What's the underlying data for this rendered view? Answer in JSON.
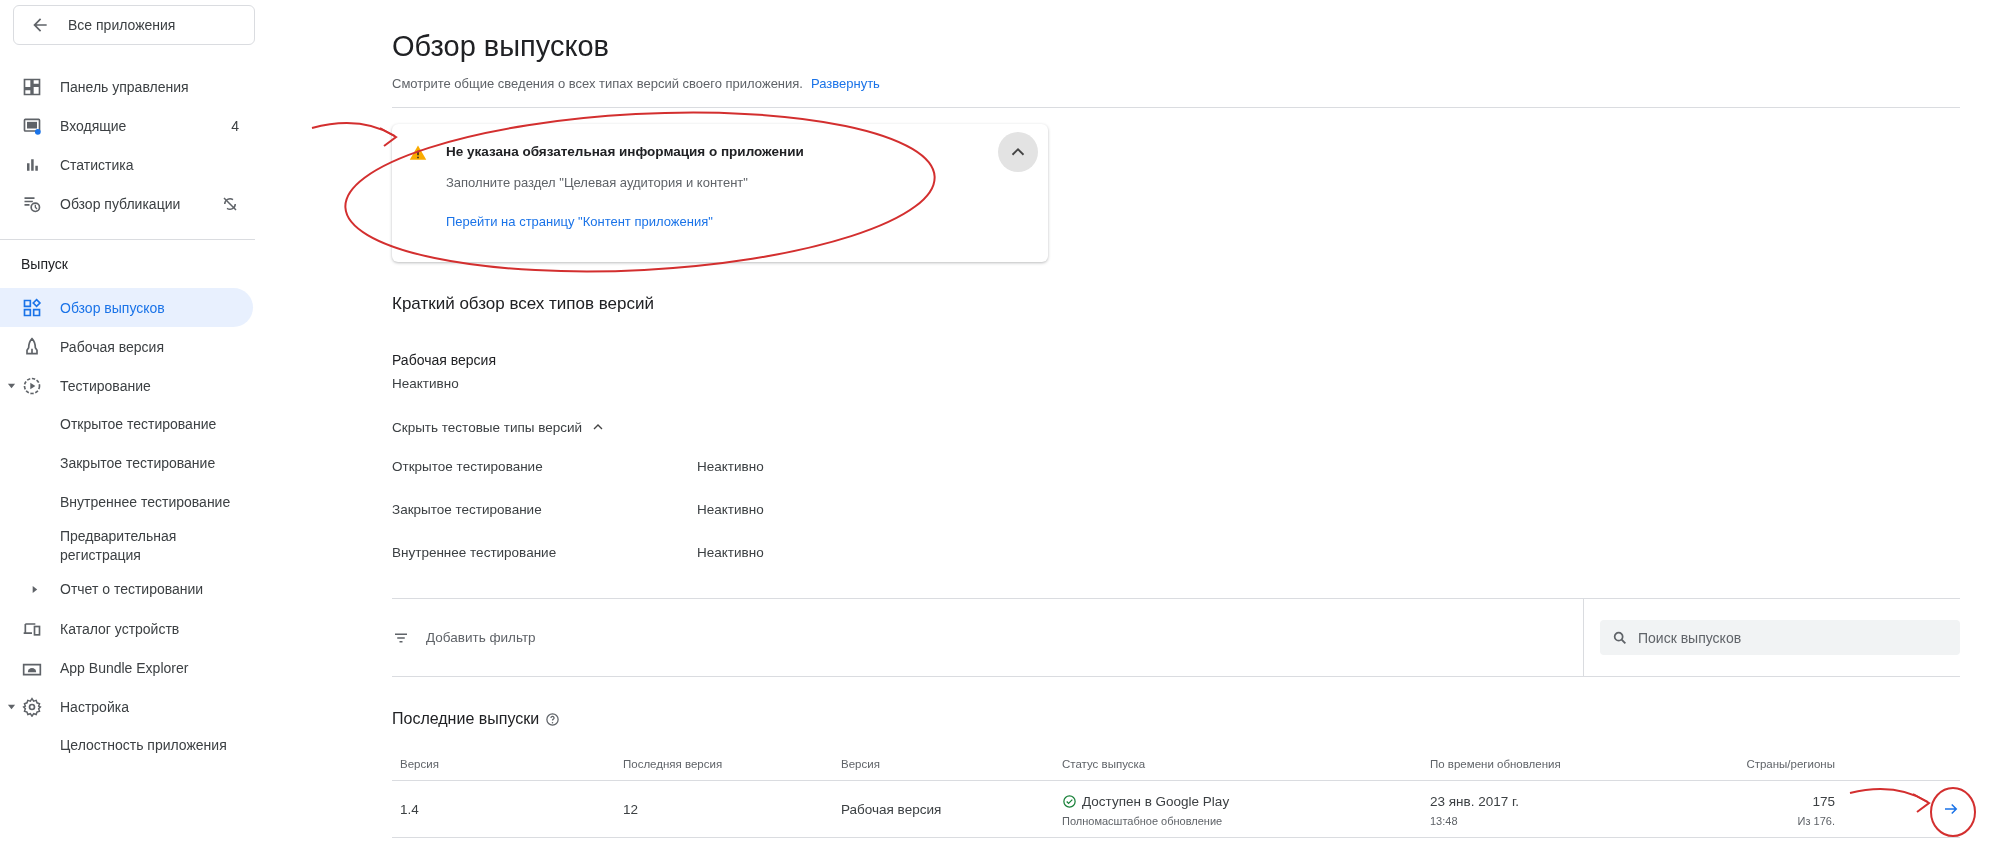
{
  "sidebar": {
    "back_button": "Все приложения",
    "items": [
      {
        "label": "Панель управления",
        "selected": false
      },
      {
        "label": "Входящие",
        "badge": "4",
        "selected": false
      },
      {
        "label": "Статистика",
        "selected": false
      },
      {
        "label": "Обзор публикации",
        "selected": false
      }
    ],
    "section_title": "Выпуск",
    "release_items": [
      {
        "label": "Обзор выпусков",
        "selected": true
      },
      {
        "label": "Рабочая версия",
        "selected": false
      },
      {
        "label": "Тестирование",
        "selected": false,
        "expanded": true,
        "children": [
          {
            "label": "Открытое тестирование",
            "selected": false
          },
          {
            "label": "Закрытое тестирование",
            "selected": false
          },
          {
            "label": "Внутреннее тестирование",
            "selected": false
          },
          {
            "label": "Предварительная регистрация",
            "selected": false
          },
          {
            "label": "Отчет о тестировании",
            "selected": false,
            "expanded": false
          }
        ]
      },
      {
        "label": "Каталог устройств",
        "selected": false
      },
      {
        "label": "App Bundle Explorer",
        "selected": false
      },
      {
        "label": "Настройка",
        "selected": false,
        "expanded": true,
        "children": [
          {
            "label": "Целостность приложения",
            "selected": false
          }
        ]
      }
    ]
  },
  "page": {
    "title": "Обзор выпусков",
    "subtitle": "Смотрите общие сведения о всех типах версий своего приложения.",
    "expand_link": "Развернуть"
  },
  "alert": {
    "title": "Не указана обязательная информация о приложении",
    "text": "Заполните раздел \"Целевая аудитория и контент\"",
    "link": "Перейти на страницу \"Контент приложения\"",
    "expanded": true
  },
  "summary": {
    "heading": "Краткий обзор всех типов версий",
    "production": {
      "label": "Рабочая версия",
      "status": "Неактивно"
    },
    "toggle": "Скрыть тестовые типы версий",
    "tests_expanded": true,
    "tracks": [
      {
        "name": "Открытое тестирование",
        "status": "Неактивно"
      },
      {
        "name": "Закрытое тестирование",
        "status": "Неактивно"
      },
      {
        "name": "Внутреннее тестирование",
        "status": "Неактивно"
      }
    ]
  },
  "filter": {
    "label": "Добавить фильтр",
    "search_placeholder": "Поиск выпусков"
  },
  "releases": {
    "heading": "Последние выпуски",
    "columns": [
      "Версия",
      "Последняя версия",
      "Версия",
      "Статус выпуска",
      "По времени обновления",
      "Страны/регионы"
    ],
    "rows": [
      {
        "version": "1.4",
        "last_version": "12",
        "track": "Рабочая версия",
        "status": "Доступен в Google Play",
        "status_note": "Полномасштабное обновление",
        "date": "23 янв. 2017 г.",
        "time": "13:48",
        "countries": "175",
        "countries_note": "Из 176."
      }
    ]
  }
}
